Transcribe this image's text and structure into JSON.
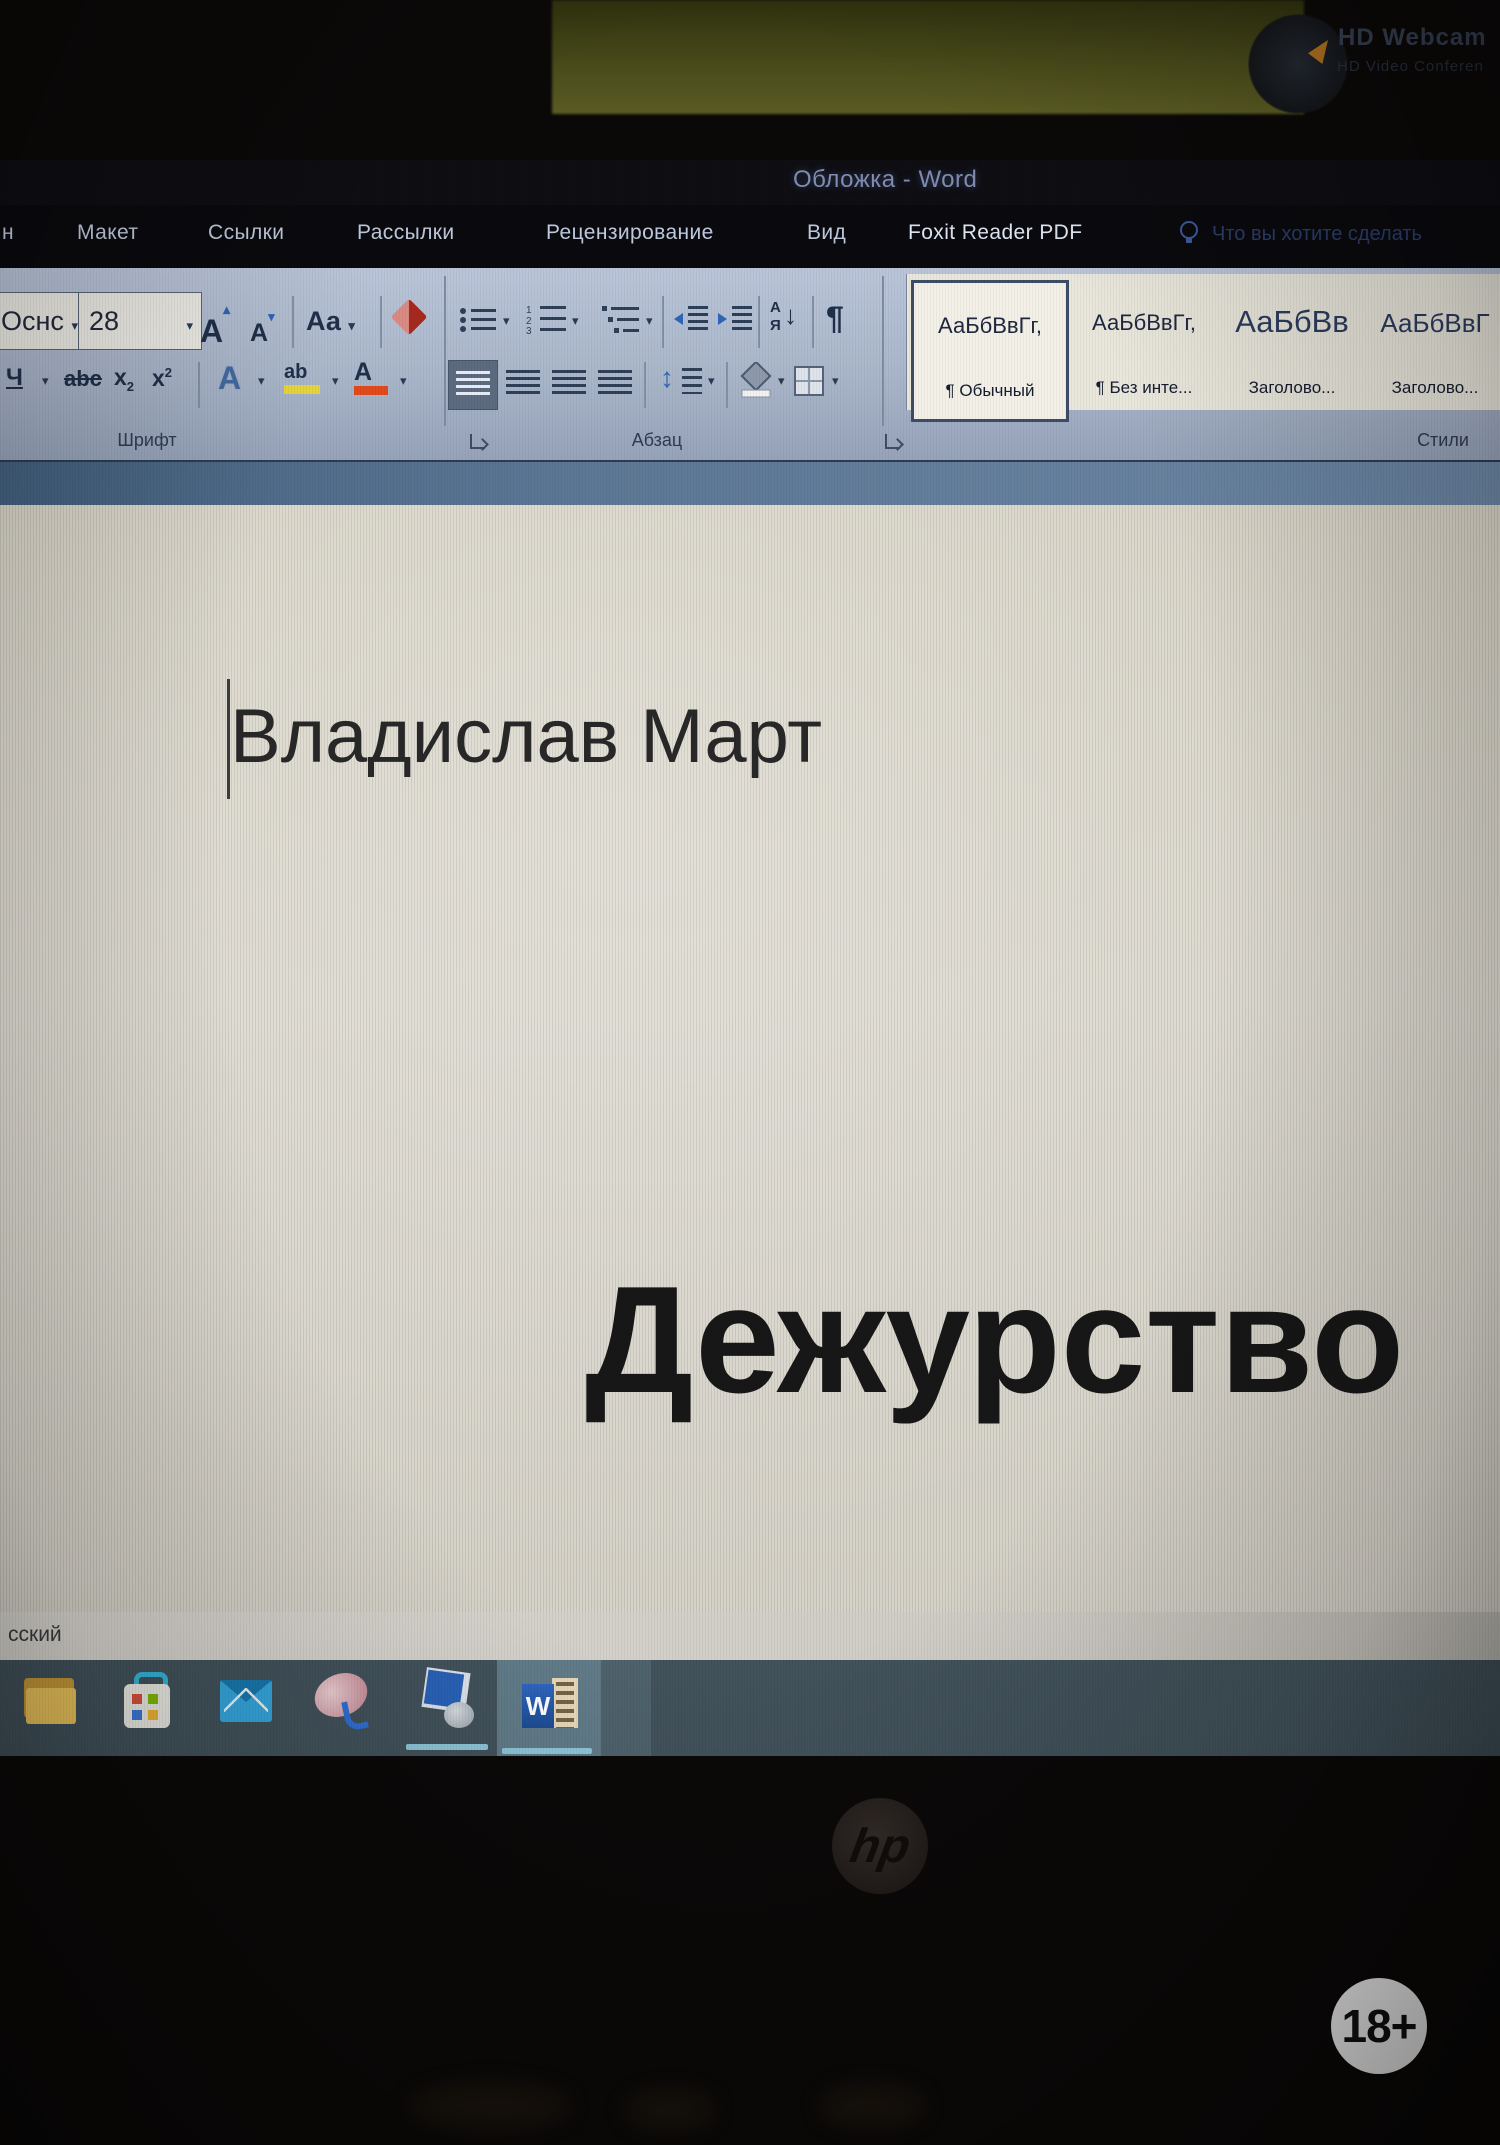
{
  "scene": {
    "sticker": {
      "line1": "HD Webcam",
      "line2": "HD Video Conferen"
    },
    "laptop_logo": "hp",
    "age_badge": "18+"
  },
  "window": {
    "title": "Обложка - Word"
  },
  "ribbon": {
    "tabs": [
      {
        "label": "н"
      },
      {
        "label": "Макет"
      },
      {
        "label": "Ссылки"
      },
      {
        "label": "Рассылки"
      },
      {
        "label": "Рецензирование"
      },
      {
        "label": "Вид"
      },
      {
        "label": "Foxit Reader PDF"
      }
    ],
    "tell_me": "Что вы хотите сделать",
    "font": {
      "name": "Оснс",
      "size": "28",
      "grow": "А",
      "shrink": "А",
      "case_label": "Аа",
      "underline": "Ч",
      "strike": "abc",
      "sub_base": "x",
      "sub_small": "2",
      "sup_base": "x",
      "sup_small": "2",
      "effects": "А",
      "highlight": "ab",
      "color_letter": "А"
    },
    "paragraph": {
      "sort_top": "А",
      "sort_bottom": "Я",
      "pilcrow": "¶"
    },
    "styles": [
      {
        "preview": "АаБбВвГг,",
        "label": "¶ Обычный"
      },
      {
        "preview": "АаБбВвГг,",
        "label": "¶ Без инте..."
      },
      {
        "preview": "АаБбВв",
        "label": "Заголово..."
      },
      {
        "preview": "АаБбВвГ",
        "label": "Заголово..."
      }
    ],
    "group_labels": {
      "font": "Шрифт",
      "paragraph": "Абзац",
      "styles": "Стили"
    }
  },
  "document": {
    "author": "Владислав Март",
    "title": "Дежурство"
  },
  "status": {
    "language": "сский"
  },
  "taskbar": {
    "icons": [
      "file-explorer",
      "microsoft-store",
      "mail",
      "paint-3d",
      "this-pc",
      "word"
    ],
    "word_letter": "W"
  },
  "colors": {
    "highlight_yellow": "#e5d43c",
    "font_color_red": "#e04a1c",
    "ribbon_bg": "#aab6ca",
    "taskbar_bg": "#42525b",
    "doc_bg": "#dbd7cc",
    "active_task_bg": "#617b88"
  }
}
